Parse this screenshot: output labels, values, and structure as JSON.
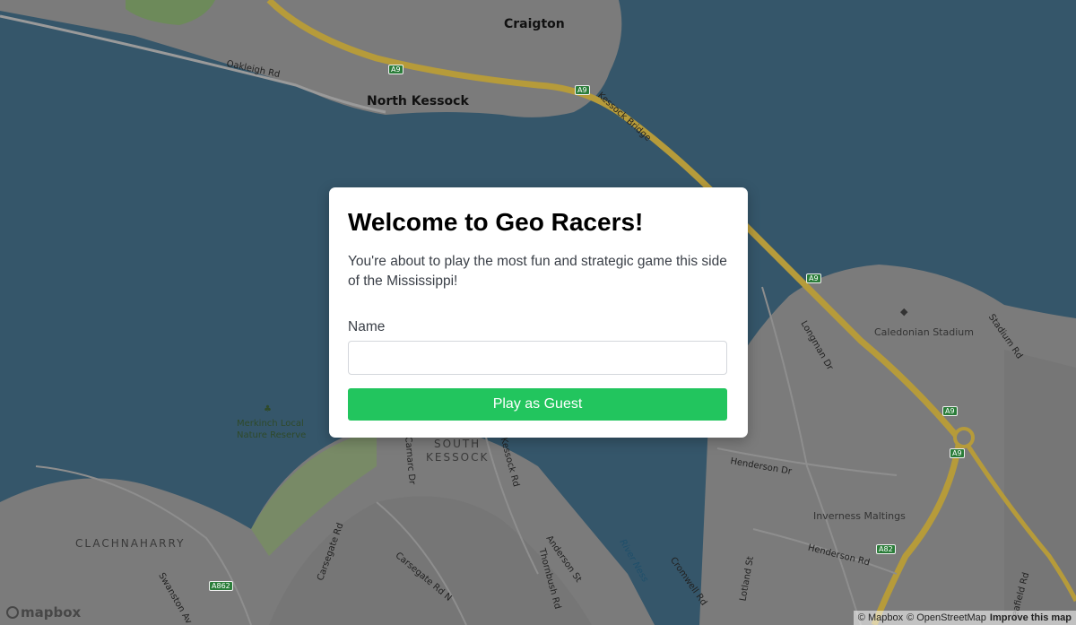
{
  "map": {
    "places": {
      "craigton": "Craigton",
      "north_kessock": "North Kessock",
      "south_kessock_1": "SOUTH",
      "south_kessock_2": "KESSOCK",
      "clachnaharry": "CLACHNAHARRY"
    },
    "streets": {
      "oakleigh_rd": "Oakleigh Rd",
      "kessock_bridge": "Kessock Bridge",
      "longman_dr": "Longman Dr",
      "stadium_rd": "Stadium Rd",
      "henderson_dr": "Henderson Dr",
      "henderson_rd": "Henderson Rd",
      "carnarc_dr": "Carnarc Dr",
      "kessock_rd": "Kessock Rd",
      "carsegate_rd": "Carsegate Rd",
      "carsegate_rd_n": "Carsegate Rd N",
      "anderson_st": "Anderson St",
      "thornbush_rd": "Thornbush Rd",
      "cromwell_rd": "Cromwell Rd",
      "lotland_st": "Lotland St",
      "swanston_av": "Swanston Av",
      "seafield_rd": "seafield Rd"
    },
    "pois": {
      "caledonian_stadium": "Caledonian Stadium",
      "merkinch_1": "Merkinch Local",
      "merkinch_2": "Nature Reserve",
      "inverness_maltings": "Inverness Maltings",
      "river_ness": "River Ness"
    },
    "shields": {
      "a9": "A9",
      "a82": "A82",
      "a862": "A862"
    },
    "colors": {
      "water": "#35566a",
      "land": "#7a7a7a",
      "road_major": "#b69b3a",
      "park": "#6f8a5a"
    }
  },
  "footer": {
    "logo_text": "mapbox",
    "attribution_mapbox": "© Mapbox",
    "attribution_osm": "© OpenStreetMap",
    "improve_link": "Improve this map"
  },
  "modal": {
    "title": "Welcome to Geo Racers!",
    "description": "You're about to play the most fun and strategic game this side of the Mississippi!",
    "name_label": "Name",
    "name_value": "",
    "name_placeholder": "",
    "play_button": "Play as Guest",
    "button_color": "#22c55e"
  }
}
